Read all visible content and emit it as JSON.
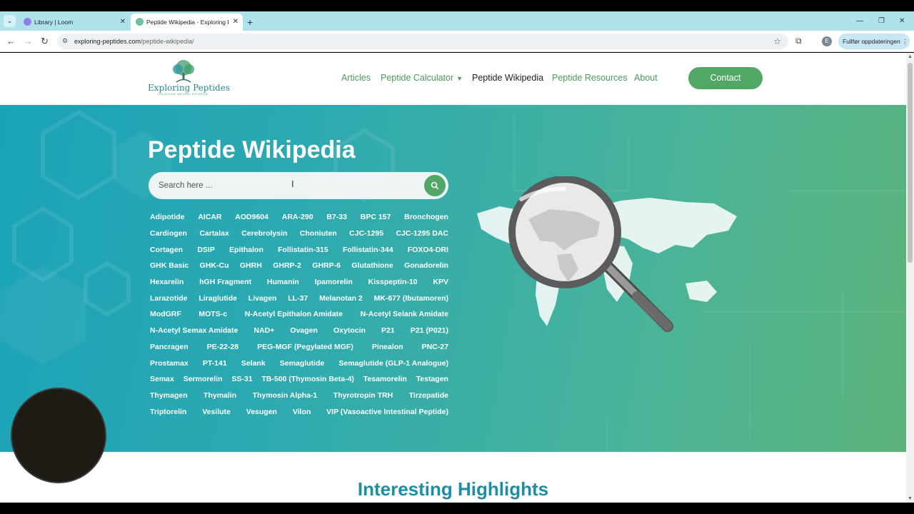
{
  "browser": {
    "tabs": [
      {
        "title": "Library | Loom",
        "active": false
      },
      {
        "title": "Peptide Wikipedia - Exploring P",
        "active": true
      }
    ],
    "url_domain": "exploring-peptides.com",
    "url_path": "/peptide-wikipedia/",
    "profile_initial": "E",
    "update_button": "Fullfør oppdateringen"
  },
  "site": {
    "logo_name": "Exploring Peptides",
    "logo_tagline": "UNLOCKING NATURAL POTENTIAL",
    "nav": [
      "Articles",
      "Peptide Calculator",
      "Peptide Wikipedia",
      "Peptide Resources",
      "About"
    ],
    "contact_label": "Contact"
  },
  "hero": {
    "title": "Peptide Wikipedia",
    "search_placeholder": "Search here ...",
    "tag_rows": [
      [
        "Adipotide",
        "AICAR",
        "AOD9604",
        "ARA-290",
        "B7-33",
        "BPC 157",
        "Bronchogen"
      ],
      [
        "Cardiogen",
        "Cartalax",
        "Cerebrolysin",
        "Choniuten",
        "CJC-1295",
        "CJC-1295 DAC"
      ],
      [
        "Cortagen",
        "DSIP",
        "Epithalon",
        "Follistatin-315",
        "Follistatin-344",
        "FOXO4-DRI"
      ],
      [
        "GHK Basic",
        "GHK-Cu",
        "GHRH",
        "GHRP-2",
        "GHRP-6",
        "Glutathione",
        "Gonadorelin"
      ],
      [
        "Hexarelin",
        "hGH Fragment",
        "Humanin",
        "Ipamorelin",
        "Kisspeptin-10",
        "KPV"
      ],
      [
        "Larazotide",
        "Liraglutide",
        "Livagen",
        "LL-37",
        "Melanotan 2",
        "MK-677 (Ibutamoren)"
      ],
      [
        "ModGRF",
        "MOTS-c",
        "N-Acetyl Epithalon Amidate",
        "N-Acetyl Selank Amidate"
      ],
      [
        "N-Acetyl Semax Amidate",
        "NAD+",
        "Ovagen",
        "Oxytocin",
        "P21",
        "P21 (P021)"
      ],
      [
        "Pancragen",
        "PE-22-28",
        "PEG-MGF (Pegylated MGF)",
        "Pinealon",
        "PNC-27"
      ],
      [
        "Prostamax",
        "PT-141",
        "Selank",
        "Semaglutide",
        "Semaglutide (GLP-1 Analogue)"
      ],
      [
        "Semax",
        "Sermorelin",
        "SS-31",
        "TB-500 (Thymosin Beta-4)",
        "Tesamorelin",
        "Testagen"
      ],
      [
        "Thymagen",
        "Thymalin",
        "Thymosin Alpha-1",
        "Thyrotropin TRH",
        "Tirzepatide"
      ],
      [
        "Triptorelin",
        "Vesilute",
        "Vesugen",
        "Vilon",
        "VIP (Vasoactive Intestinal Peptide)"
      ]
    ]
  },
  "highlights_title": "Interesting Highlights"
}
